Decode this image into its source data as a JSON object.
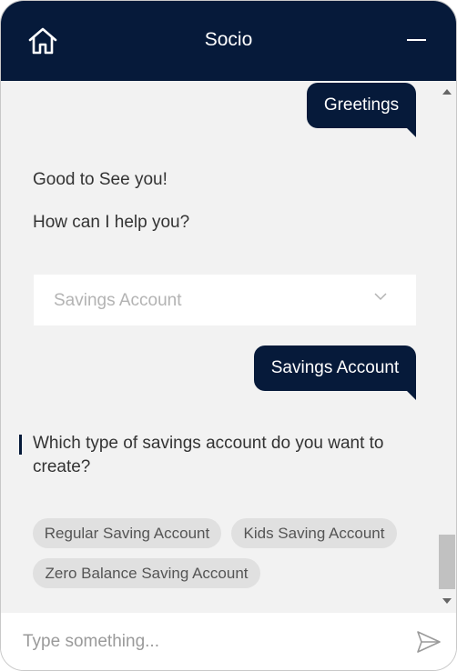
{
  "header": {
    "title": "Socio",
    "home_icon": "home-icon",
    "minimize_icon": "minimize-icon",
    "background": "#061a3a"
  },
  "chat": {
    "user_messages": [
      "Greetings",
      "Savings Account"
    ],
    "bot_greeting": "Good to See you!",
    "bot_help": "How can I help you?",
    "dropdown": {
      "selected": "Savings Account",
      "icon": "chevron-down-icon"
    },
    "question": "Which type of savings account do you want to create?",
    "options": [
      "Regular Saving Account",
      "Kids Saving Account",
      "Zero Balance Saving Account"
    ]
  },
  "composer": {
    "placeholder": "Type something...",
    "send_icon": "send-icon"
  },
  "colors": {
    "brand": "#061a3a",
    "chat_bg": "#f2f2f2",
    "chip_bg": "#e0e0e0"
  }
}
